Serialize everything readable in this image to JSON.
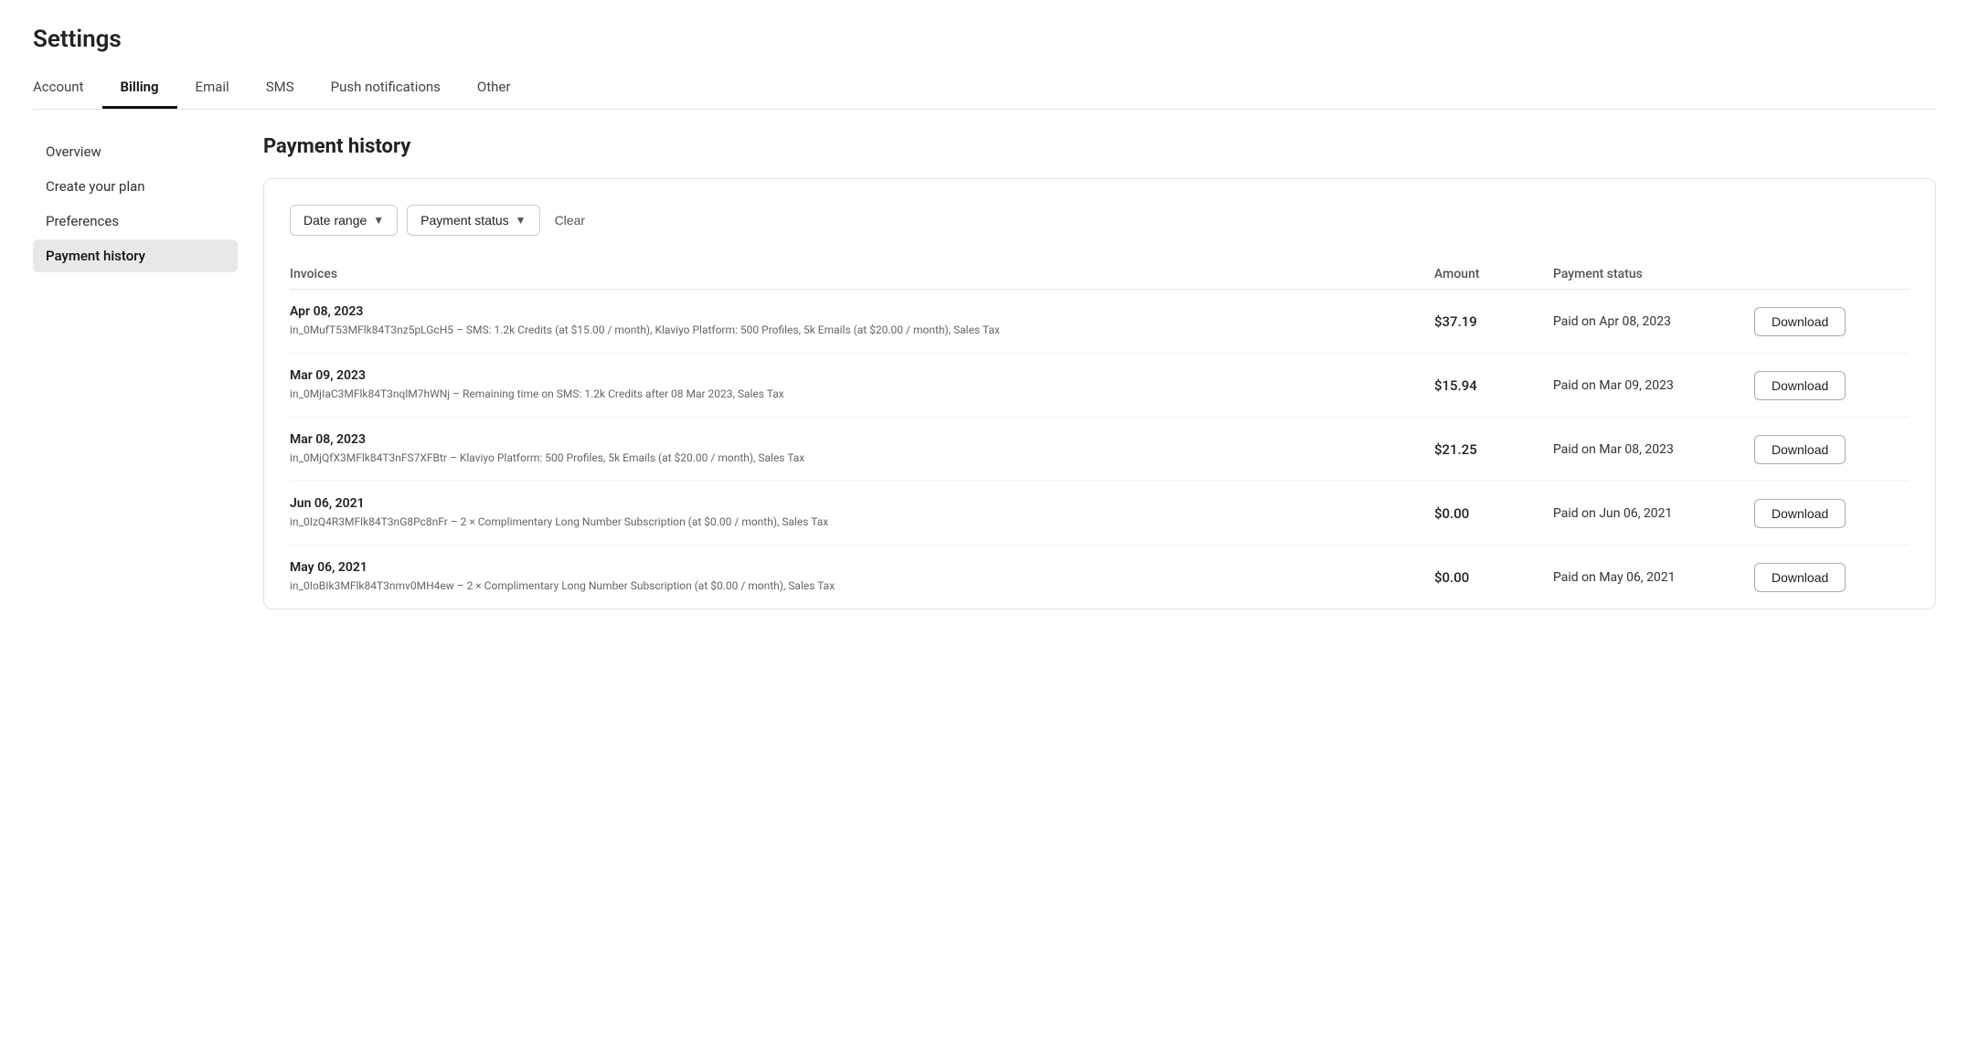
{
  "page": {
    "title": "Settings"
  },
  "topNav": {
    "items": [
      {
        "id": "account",
        "label": "Account",
        "active": false
      },
      {
        "id": "billing",
        "label": "Billing",
        "active": true
      },
      {
        "id": "email",
        "label": "Email",
        "active": false
      },
      {
        "id": "sms",
        "label": "SMS",
        "active": false
      },
      {
        "id": "push-notifications",
        "label": "Push notifications",
        "active": false
      },
      {
        "id": "other",
        "label": "Other",
        "active": false
      }
    ]
  },
  "sidebar": {
    "items": [
      {
        "id": "overview",
        "label": "Overview",
        "active": false
      },
      {
        "id": "create-your-plan",
        "label": "Create your plan",
        "active": false
      },
      {
        "id": "preferences",
        "label": "Preferences",
        "active": false
      },
      {
        "id": "payment-history",
        "label": "Payment history",
        "active": true
      }
    ]
  },
  "main": {
    "sectionTitle": "Payment history",
    "filters": {
      "dateRange": {
        "label": "Date range"
      },
      "paymentStatus": {
        "label": "Payment status"
      },
      "clear": {
        "label": "Clear"
      }
    },
    "table": {
      "headers": [
        "Invoices",
        "Amount",
        "Payment status",
        ""
      ],
      "rows": [
        {
          "date": "Apr 08, 2023",
          "id": "in_0MufT53MFlk84T3nz5pLGcH5",
          "description": "SMS: 1.2k Credits (at $15.00 / month), Klaviyo Platform: 500 Profiles, 5k Emails (at $20.00 / month), Sales Tax",
          "amount": "$37.19",
          "status": "Paid on Apr 08, 2023",
          "downloadLabel": "Download"
        },
        {
          "date": "Mar 09, 2023",
          "id": "in_0MjIaC3MFlk84T3nqlM7hWNj",
          "description": "Remaining time on SMS: 1.2k Credits after 08 Mar 2023, Sales Tax",
          "amount": "$15.94",
          "status": "Paid on Mar 09, 2023",
          "downloadLabel": "Download"
        },
        {
          "date": "Mar 08, 2023",
          "id": "in_0MjQfX3MFlk84T3nFS7XFBtr",
          "description": "Klaviyo Platform: 500 Profiles, 5k Emails (at $20.00 / month), Sales Tax",
          "amount": "$21.25",
          "status": "Paid on Mar 08, 2023",
          "downloadLabel": "Download"
        },
        {
          "date": "Jun 06, 2021",
          "id": "in_0IzQ4R3MFlk84T3nG8Pc8nFr",
          "description": "2 × Complimentary Long Number Subscription (at $0.00 / month), Sales Tax",
          "amount": "$0.00",
          "status": "Paid on Jun 06, 2021",
          "downloadLabel": "Download"
        },
        {
          "date": "May 06, 2021",
          "id": "in_0IoBIk3MFlk84T3nmv0MH4ew",
          "description": "2 × Complimentary Long Number Subscription (at $0.00 / month), Sales Tax",
          "amount": "$0.00",
          "status": "Paid on May 06, 2021",
          "downloadLabel": "Download"
        }
      ]
    }
  }
}
